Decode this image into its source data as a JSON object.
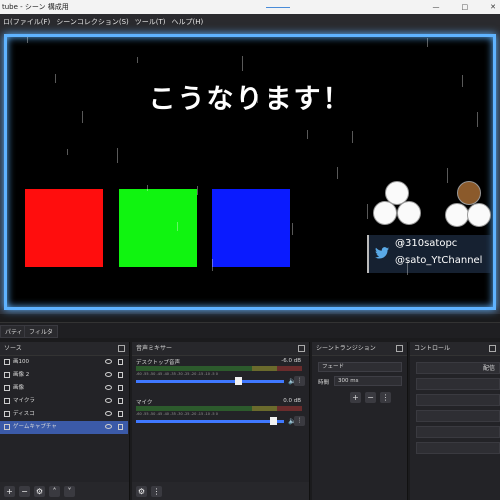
{
  "window": {
    "title": "tube - シーン 構成用",
    "controls": [
      "—",
      "□",
      "✕"
    ]
  },
  "menu": [
    "ロ(ファイル(F)",
    "シーンコレクション(S)",
    "ツール(T)",
    "ヘルプ(H)"
  ],
  "preview": {
    "headline": "こうなります！",
    "handle1": "@310satopc",
    "handle2": "@sato_YtChannel"
  },
  "tabs": {
    "properties": "パティ",
    "filters": "フィルタ"
  },
  "sources": {
    "title": "ソース",
    "items": [
      {
        "label": "画100",
        "selected": false
      },
      {
        "label": "画像 2",
        "selected": false
      },
      {
        "label": "画像",
        "selected": false
      },
      {
        "label": "マイクラ",
        "selected": false
      },
      {
        "label": "ディスコ",
        "selected": false
      },
      {
        "label": "ゲームキャプチャ",
        "selected": true
      }
    ]
  },
  "mixer": {
    "title": "音声ミキサー",
    "channels": [
      {
        "name": "デスクトップ音声",
        "db": "-6.0 dB",
        "level": 0.7
      },
      {
        "name": "マイク",
        "db": "0.0 dB",
        "level": 0.95
      }
    ],
    "scale": "-60 -55 -50 -45 -40 -35 -30 -25 -20 -15 -10 -5 0"
  },
  "transitions": {
    "title": "シーントランジション",
    "type": "フェード",
    "duration_label": "時間",
    "duration": "300 ms"
  },
  "controls": {
    "title": "コントロール",
    "start_label": "配信"
  }
}
